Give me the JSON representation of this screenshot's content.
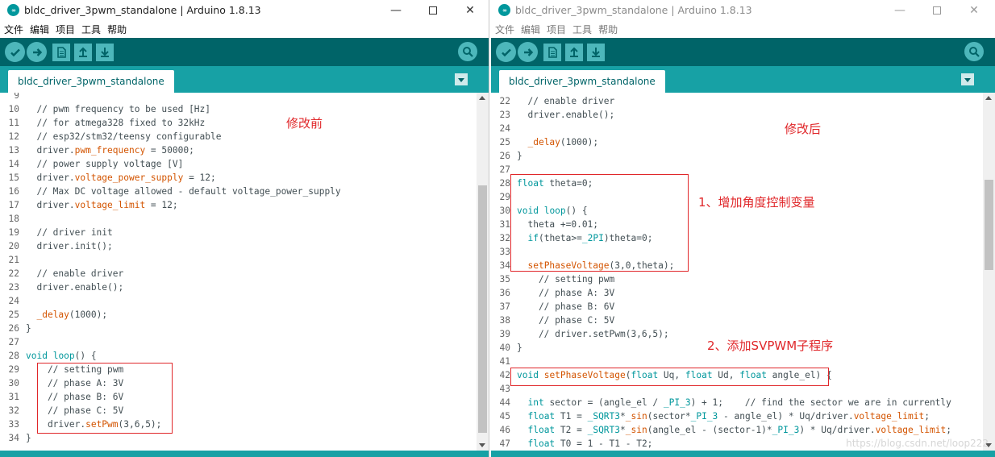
{
  "colors": {
    "toolbar": "#006468",
    "tabbar": "#17a1a5",
    "button": "#4db7bb",
    "keyword": "#00979c",
    "function": "#d35400",
    "annotation": "#e0272a"
  },
  "left": {
    "title": "bldc_driver_3pwm_standalone | Arduino 1.8.13",
    "menu": [
      "文件",
      "编辑",
      "项目",
      "工具",
      "帮助"
    ],
    "tab": "bldc_driver_3pwm_standalone",
    "annotation": "修改前",
    "lines": [
      {
        "n": "9",
        "t": []
      },
      {
        "n": "10",
        "t": [
          [
            "",
            "  // pwm frequency to be used [Hz]"
          ]
        ]
      },
      {
        "n": "11",
        "t": [
          [
            "",
            "  // for atmega328 fixed to 32kHz"
          ]
        ]
      },
      {
        "n": "12",
        "t": [
          [
            "",
            "  // esp32/stm32/teensy configurable"
          ]
        ]
      },
      {
        "n": "13",
        "t": [
          [
            "",
            "  driver."
          ],
          [
            "fn",
            "pwm_frequency"
          ],
          [
            "",
            " = 50000;"
          ]
        ]
      },
      {
        "n": "14",
        "t": [
          [
            "",
            "  // power supply voltage [V]"
          ]
        ]
      },
      {
        "n": "15",
        "t": [
          [
            "",
            "  driver."
          ],
          [
            "fn",
            "voltage_power_supply"
          ],
          [
            "",
            " = 12;"
          ]
        ]
      },
      {
        "n": "16",
        "t": [
          [
            "",
            "  // Max DC voltage allowed - default voltage_power_supply"
          ]
        ]
      },
      {
        "n": "17",
        "t": [
          [
            "",
            "  driver."
          ],
          [
            "fn",
            "voltage_limit"
          ],
          [
            "",
            " = 12;"
          ]
        ]
      },
      {
        "n": "18",
        "t": []
      },
      {
        "n": "19",
        "t": [
          [
            "",
            "  // driver init"
          ]
        ]
      },
      {
        "n": "20",
        "t": [
          [
            "",
            "  driver.init();"
          ]
        ]
      },
      {
        "n": "21",
        "t": []
      },
      {
        "n": "22",
        "t": [
          [
            "",
            "  // enable driver"
          ]
        ]
      },
      {
        "n": "23",
        "t": [
          [
            "",
            "  driver.enable();"
          ]
        ]
      },
      {
        "n": "24",
        "t": []
      },
      {
        "n": "25",
        "t": [
          [
            "",
            "  "
          ],
          [
            "fn",
            "_delay"
          ],
          [
            "",
            "(1000);"
          ]
        ]
      },
      {
        "n": "26",
        "t": [
          [
            "",
            "}"
          ]
        ]
      },
      {
        "n": "27",
        "t": []
      },
      {
        "n": "28",
        "t": [
          [
            "kw",
            "void"
          ],
          [
            "",
            " "
          ],
          [
            "kw",
            "loop"
          ],
          [
            "",
            "() {"
          ]
        ]
      },
      {
        "n": "29",
        "t": [
          [
            "",
            "    // setting pwm"
          ]
        ]
      },
      {
        "n": "30",
        "t": [
          [
            "",
            "    // phase A: 3V"
          ]
        ]
      },
      {
        "n": "31",
        "t": [
          [
            "",
            "    // phase B: 6V"
          ]
        ]
      },
      {
        "n": "32",
        "t": [
          [
            "",
            "    // phase C: 5V"
          ]
        ]
      },
      {
        "n": "33",
        "t": [
          [
            "",
            "    driver."
          ],
          [
            "fn",
            "setPwm"
          ],
          [
            "",
            "(3,6,5);"
          ]
        ]
      },
      {
        "n": "34",
        "t": [
          [
            "",
            "}"
          ]
        ]
      }
    ]
  },
  "right": {
    "title": "bldc_driver_3pwm_standalone | Arduino 1.8.13",
    "menu": [
      "文件",
      "编辑",
      "项目",
      "工具",
      "帮助"
    ],
    "tab": "bldc_driver_3pwm_standalone",
    "annotation_top": "修改后",
    "annotation_1": "1、增加角度控制变量",
    "annotation_2": "2、添加SVPWM子程序",
    "watermark": "https://blog.csdn.net/loop222",
    "lines": [
      {
        "n": "22",
        "t": [
          [
            "",
            "  // enable driver"
          ]
        ]
      },
      {
        "n": "23",
        "t": [
          [
            "",
            "  driver.enable();"
          ]
        ]
      },
      {
        "n": "24",
        "t": []
      },
      {
        "n": "25",
        "t": [
          [
            "",
            "  "
          ],
          [
            "fn",
            "_delay"
          ],
          [
            "",
            "(1000);"
          ]
        ]
      },
      {
        "n": "26",
        "t": [
          [
            "",
            "}"
          ]
        ]
      },
      {
        "n": "27",
        "t": []
      },
      {
        "n": "28",
        "t": [
          [
            "kw",
            "float"
          ],
          [
            "",
            " theta=0;"
          ]
        ]
      },
      {
        "n": "29",
        "t": []
      },
      {
        "n": "30",
        "t": [
          [
            "kw",
            "void"
          ],
          [
            "",
            " "
          ],
          [
            "kw",
            "loop"
          ],
          [
            "",
            "() {"
          ]
        ]
      },
      {
        "n": "31",
        "t": [
          [
            "",
            "  theta +=0.01;"
          ]
        ]
      },
      {
        "n": "32",
        "t": [
          [
            "",
            "  "
          ],
          [
            "kw",
            "if"
          ],
          [
            "",
            "(theta>="
          ],
          [
            "kw",
            "_2PI"
          ],
          [
            "",
            ")theta=0;"
          ]
        ]
      },
      {
        "n": "33",
        "t": []
      },
      {
        "n": "34",
        "t": [
          [
            "",
            "  "
          ],
          [
            "fn",
            "setPhaseVoltage"
          ],
          [
            "",
            "(3,0,theta);"
          ]
        ]
      },
      {
        "n": "35",
        "t": [
          [
            "",
            "    // setting pwm"
          ]
        ]
      },
      {
        "n": "36",
        "t": [
          [
            "",
            "    // phase A: 3V"
          ]
        ]
      },
      {
        "n": "37",
        "t": [
          [
            "",
            "    // phase B: 6V"
          ]
        ]
      },
      {
        "n": "38",
        "t": [
          [
            "",
            "    // phase C: 5V"
          ]
        ]
      },
      {
        "n": "39",
        "t": [
          [
            "",
            "    // driver.setPwm(3,6,5);"
          ]
        ]
      },
      {
        "n": "40",
        "t": [
          [
            "",
            "}"
          ]
        ]
      },
      {
        "n": "41",
        "t": []
      },
      {
        "n": "42",
        "t": [
          [
            "kw",
            "void"
          ],
          [
            "",
            " "
          ],
          [
            "fn",
            "setPhaseVoltage"
          ],
          [
            "",
            "("
          ],
          [
            "kw",
            "float"
          ],
          [
            "",
            " Uq, "
          ],
          [
            "kw",
            "float"
          ],
          [
            "",
            " Ud, "
          ],
          [
            "kw",
            "float"
          ],
          [
            "",
            " angle_el) {"
          ]
        ]
      },
      {
        "n": "43",
        "t": []
      },
      {
        "n": "44",
        "t": [
          [
            "",
            "  "
          ],
          [
            "kw",
            "int"
          ],
          [
            "",
            " sector = (angle_el / "
          ],
          [
            "kw",
            "_PI_3"
          ],
          [
            "",
            ") + 1;    // find the sector we are in currently"
          ]
        ]
      },
      {
        "n": "45",
        "t": [
          [
            "",
            "  "
          ],
          [
            "kw",
            "float"
          ],
          [
            "",
            " T1 = "
          ],
          [
            "kw",
            "_SQRT3"
          ],
          [
            "",
            "*"
          ],
          [
            "fn",
            "_sin"
          ],
          [
            "",
            "(sector*"
          ],
          [
            "kw",
            "_PI_3"
          ],
          [
            "",
            " - angle_el) * Uq/driver."
          ],
          [
            "fn",
            "voltage_limit"
          ],
          [
            "",
            ";"
          ]
        ]
      },
      {
        "n": "46",
        "t": [
          [
            "",
            "  "
          ],
          [
            "kw",
            "float"
          ],
          [
            "",
            " T2 = "
          ],
          [
            "kw",
            "_SQRT3"
          ],
          [
            "",
            "*"
          ],
          [
            "fn",
            "_sin"
          ],
          [
            "",
            "(angle_el - (sector-1)*"
          ],
          [
            "kw",
            "_PI_3"
          ],
          [
            "",
            ") * Uq/driver."
          ],
          [
            "fn",
            "voltage_limit"
          ],
          [
            "",
            ";"
          ]
        ]
      },
      {
        "n": "47",
        "t": [
          [
            "",
            "  "
          ],
          [
            "kw",
            "float"
          ],
          [
            "",
            " T0 = 1 - T1 - T2;"
          ]
        ]
      }
    ]
  }
}
